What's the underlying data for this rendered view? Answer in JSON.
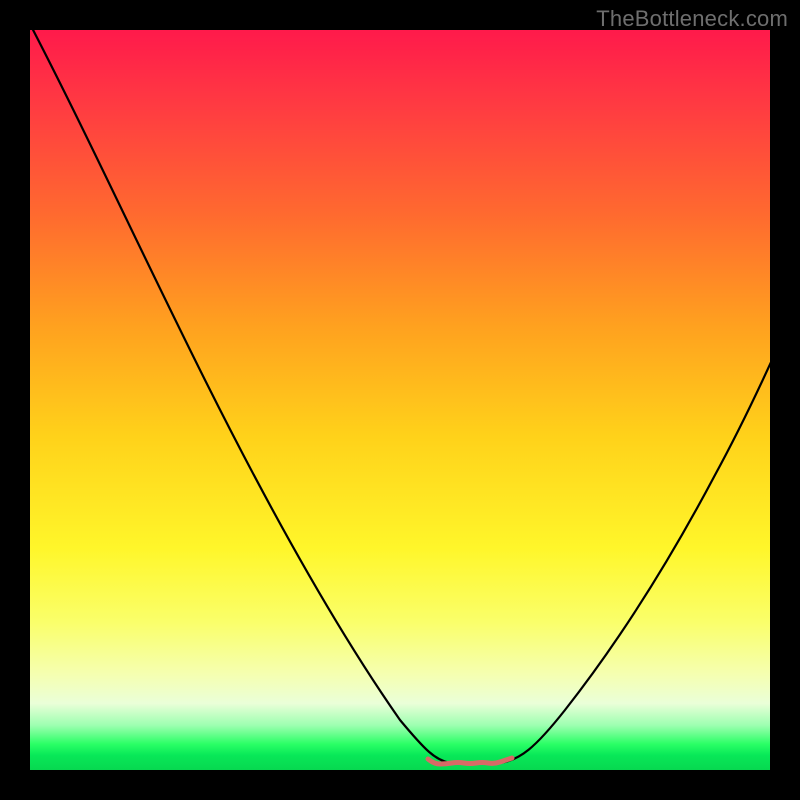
{
  "watermark": "TheBottleneck.com",
  "colors": {
    "frame": "#000000",
    "curve": "#000000",
    "bottom_marker": "#d86a66",
    "watermark_text": "#6e6e6e"
  },
  "chart_data": {
    "type": "line",
    "title": "",
    "xlabel": "",
    "ylabel": "",
    "xlim": [
      0,
      100
    ],
    "ylim": [
      0,
      100
    ],
    "grid": false,
    "legend": false,
    "annotations": [
      "TheBottleneck.com"
    ],
    "series": [
      {
        "name": "bottleneck-curve",
        "x": [
          0,
          6,
          12,
          18,
          24,
          30,
          36,
          42,
          48,
          52,
          55,
          58,
          61,
          64,
          68,
          74,
          80,
          86,
          92,
          97,
          100
        ],
        "values": [
          100,
          90,
          80,
          70,
          60,
          50,
          40,
          30,
          18,
          10,
          5,
          2,
          1,
          2,
          5,
          13,
          24,
          36,
          48,
          58,
          64
        ]
      },
      {
        "name": "optimal-range-marker",
        "x": [
          54,
          55,
          56,
          57,
          58,
          59,
          60,
          61,
          62,
          63,
          64,
          65
        ],
        "values": [
          2,
          1.2,
          0.9,
          0.7,
          0.6,
          0.6,
          0.6,
          0.6,
          0.7,
          0.9,
          1.2,
          2
        ]
      }
    ]
  }
}
